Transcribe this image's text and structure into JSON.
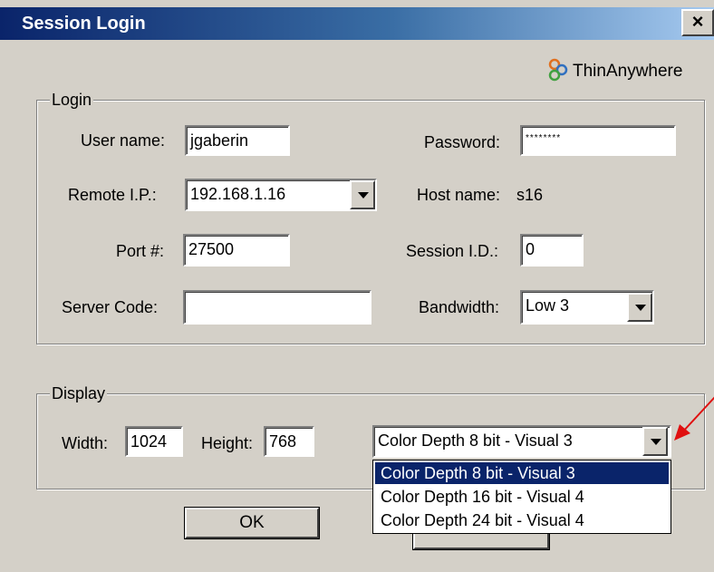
{
  "window": {
    "title": "Session Login",
    "close_glyph": "×"
  },
  "brand": {
    "name": "ThinAnywhere",
    "icon": "thinanywhere-logo-icon"
  },
  "login": {
    "group_label": "Login",
    "username_label": "User name:",
    "username_value": "jgaberin",
    "password_label": "Password:",
    "password_value": "********",
    "remote_ip_label": "Remote I.P.:",
    "remote_ip_value": "192.168.1.16",
    "hostname_label": "Host name:",
    "hostname_value": "s16",
    "port_label": "Port #:",
    "port_value": "27500",
    "session_id_label": "Session I.D.:",
    "session_id_value": "0",
    "server_code_label": "Server Code:",
    "server_code_value": "",
    "bandwidth_label": "Bandwidth:",
    "bandwidth_value": "Low 3"
  },
  "display": {
    "group_label": "Display",
    "width_label": "Width:",
    "width_value": "1024",
    "height_label": "Height:",
    "height_value": "768",
    "color_depth_value": "Color Depth 8 bit   - Visual 3",
    "color_depth_options": [
      "Color Depth 8 bit   - Visual 3",
      "Color Depth 16 bit - Visual 4",
      "Color Depth 24 bit - Visual 4"
    ],
    "selected_option_index": 0
  },
  "buttons": {
    "ok_label": "OK"
  },
  "colors": {
    "title_start": "#0a246a",
    "title_end": "#a6caf0",
    "dialog_bg": "#d4d0c8",
    "selection": "#0a246a",
    "annotation_arrow": "#e01010"
  }
}
